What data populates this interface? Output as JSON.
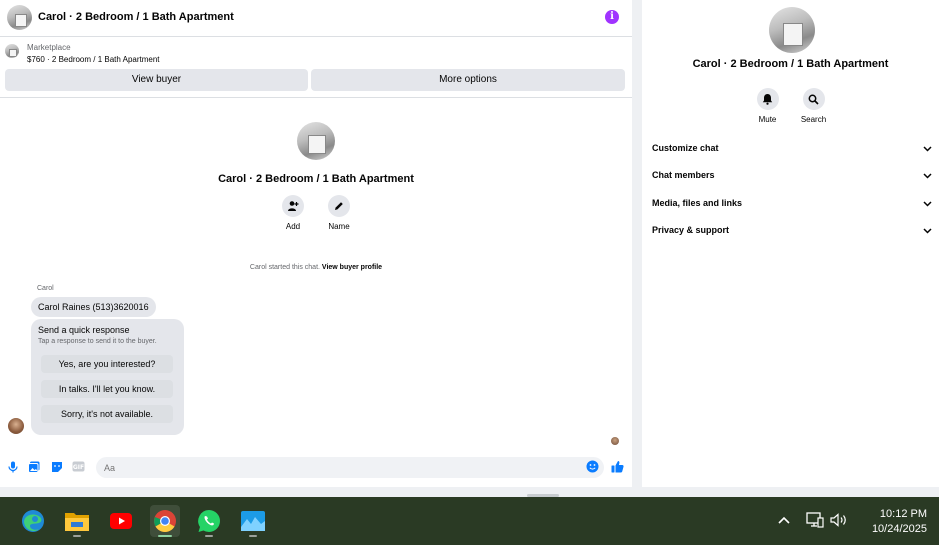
{
  "chat": {
    "header_title": "Carol · 2 Bedroom / 1 Bath Apartment",
    "listing": {
      "source": "Marketplace",
      "price_line": "$760 · 2 Bedroom / 1 Bath Apartment",
      "view_buyer_label": "View buyer",
      "more_options_label": "More options"
    },
    "profile": {
      "name": "Carol · 2 Bedroom / 1 Bath Apartment",
      "add_label": "Add",
      "name_label": "Name"
    },
    "started_text": "Carol started this chat.",
    "started_link": "View buyer profile",
    "sender": "Carol",
    "message": "Carol Raines (513)3620016",
    "quick_response": {
      "title": "Send a quick response",
      "subtitle": "Tap a response to send it to the buyer.",
      "options": [
        "Yes, are you interested?",
        "In talks. I'll let you know.",
        "Sorry, it's not available."
      ]
    },
    "composer": {
      "placeholder": "Aa"
    }
  },
  "info_panel": {
    "name": "Carol · 2 Bedroom / 1 Bath Apartment",
    "mute_label": "Mute",
    "search_label": "Search",
    "sections": [
      "Customize chat",
      "Chat members",
      "Media, files and links",
      "Privacy & support"
    ]
  },
  "taskbar": {
    "apps": [
      "edge-icon",
      "file-explorer-icon",
      "youtube-icon",
      "chrome-icon",
      "whatsapp-icon",
      "photos-icon"
    ],
    "time": "10:12 PM",
    "date": "10/24/2025"
  },
  "colors": {
    "accent_blue": "#0a7cff",
    "info_purple": "#a033ff",
    "taskbar": "#2a3a24"
  }
}
